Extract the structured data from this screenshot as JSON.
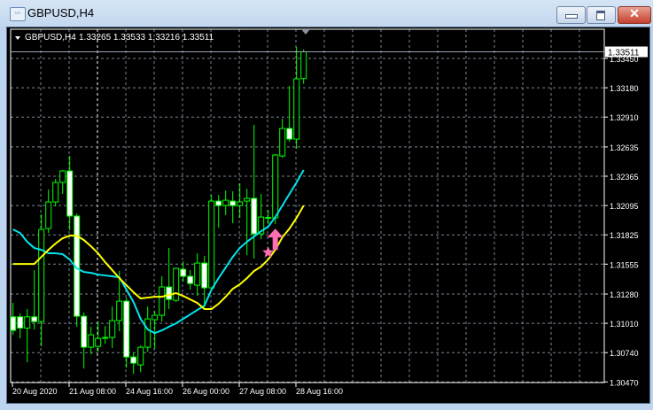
{
  "window": {
    "title": "GBPUSD,H4",
    "buttons": [
      "minimize",
      "maximize",
      "close"
    ]
  },
  "chart_header": {
    "symbol": "GBPUSD,H4",
    "ohlc": "1.33265 1.33533 1.33216 1.33511"
  },
  "colors": {
    "background": "#000000",
    "candle_outline": "#00ff00",
    "bull_body": "#000000",
    "bear_body": "#ffffff",
    "ma_fast": "#00e5ee",
    "ma_slow": "#ffff00",
    "grid": "#7a8594",
    "signal": "#ff6eb4"
  },
  "chart_data": {
    "type": "candlestick",
    "title": "GBPUSD,H4",
    "ylim": [
      1.30464,
      1.33719
    ],
    "grid": true,
    "price_labels": [
      "1.33450",
      "1.33180",
      "1.32910",
      "1.32635",
      "1.32365",
      "1.32095",
      "1.31825",
      "1.31555",
      "1.31280",
      "1.31010",
      "1.30740",
      "1.30470"
    ],
    "time_labels": [
      "20 Aug 2020",
      "21 Aug 08:00",
      "24 Aug 16:00",
      "26 Aug 00:00",
      "27 Aug 08:00",
      "28 Aug 16:00"
    ],
    "current_price": "1.33511",
    "candles": [
      [
        1.3107,
        1.31198,
        1.30904,
        1.30945
      ],
      [
        1.3107,
        1.311,
        1.30871,
        1.30966
      ],
      [
        1.30966,
        1.31141,
        1.30651,
        1.3107
      ],
      [
        1.3107,
        1.315,
        1.30953,
        1.31026
      ],
      [
        1.31026,
        1.32014,
        1.30798,
        1.31875
      ],
      [
        1.31883,
        1.32242,
        1.31842,
        1.32128
      ],
      [
        1.32128,
        1.3234,
        1.32087,
        1.32308
      ],
      [
        1.32308,
        1.32422,
        1.32202,
        1.32414
      ],
      [
        1.32414,
        1.32552,
        1.31867,
        1.31998
      ],
      [
        1.31998,
        1.32022,
        1.30978,
        1.31075
      ],
      [
        1.31075,
        1.31108,
        1.30594,
        1.3079
      ],
      [
        1.3079,
        1.30978,
        1.30725,
        1.30904
      ],
      [
        1.30798,
        1.31026,
        1.30749,
        1.30871
      ],
      [
        1.3088,
        1.30986,
        1.30822,
        1.30878
      ],
      [
        1.3088,
        1.31165,
        1.30782,
        1.31035
      ],
      [
        1.31035,
        1.31492,
        1.30937,
        1.31214
      ],
      [
        1.31214,
        1.31247,
        1.30602,
        1.307
      ],
      [
        1.307,
        1.30741,
        1.30545,
        1.30643
      ],
      [
        1.30627,
        1.30806,
        1.30561,
        1.3079
      ],
      [
        1.3079,
        1.31165,
        1.30749,
        1.31051
      ],
      [
        1.31043,
        1.31124,
        1.30774,
        1.31084
      ],
      [
        1.31084,
        1.31443,
        1.31026,
        1.31345
      ],
      [
        1.31345,
        1.31704,
        1.31141,
        1.3123
      ],
      [
        1.31222,
        1.31524,
        1.31206,
        1.31516
      ],
      [
        1.31508,
        1.31581,
        1.31394,
        1.31443
      ],
      [
        1.31443,
        1.315,
        1.3132,
        1.31377
      ],
      [
        1.31361,
        1.31655,
        1.31263,
        1.31565
      ],
      [
        1.31565,
        1.3163,
        1.31157,
        1.31337
      ],
      [
        1.31337,
        1.32193,
        1.3132,
        1.32136
      ],
      [
        1.32136,
        1.32193,
        1.31891,
        1.32095
      ],
      [
        1.32095,
        1.32234,
        1.32006,
        1.32144
      ],
      [
        1.32136,
        1.32226,
        1.31932,
        1.32095
      ],
      [
        1.32095,
        1.32299,
        1.31981,
        1.32128
      ],
      [
        1.32136,
        1.3225,
        1.31638,
        1.32161
      ],
      [
        1.32161,
        1.32838,
        1.31606,
        1.31834
      ],
      [
        1.31834,
        1.32202,
        1.31785,
        1.31989
      ],
      [
        1.31981,
        1.32055,
        1.31924,
        1.31985
      ],
      [
        1.31981,
        1.32569,
        1.31924,
        1.32561
      ],
      [
        1.32552,
        1.32895,
        1.32536,
        1.32805
      ],
      [
        1.32805,
        1.33197,
        1.32683,
        1.32707
      ],
      [
        1.32707,
        1.33556,
        1.32618,
        1.33262
      ],
      [
        1.33265,
        1.33533,
        1.33216,
        1.33511
      ]
    ],
    "ma_fast": [
      1.31875,
      1.31842,
      1.31761,
      1.31704,
      1.31687,
      1.31655,
      1.31655,
      1.31647,
      1.31598,
      1.31516,
      1.31483,
      1.31475,
      1.31459,
      1.31451,
      1.31443,
      1.31434,
      1.3132,
      1.31206,
      1.31051,
      1.30953,
      1.3092,
      1.30945,
      1.30978,
      1.3101,
      1.31051,
      1.31092,
      1.31133,
      1.31173,
      1.3132,
      1.31426,
      1.31524,
      1.31622,
      1.31704,
      1.31761,
      1.3181,
      1.31859,
      1.319,
      1.31989,
      1.32095,
      1.32202,
      1.32308,
      1.32422
    ],
    "ma_slow": [
      1.31557,
      1.31557,
      1.31557,
      1.31557,
      1.31622,
      1.31687,
      1.31745,
      1.31794,
      1.31818,
      1.31818,
      1.31777,
      1.3172,
      1.31655,
      1.31573,
      1.315,
      1.31426,
      1.31361,
      1.31296,
      1.31239,
      1.31247,
      1.31255,
      1.31255,
      1.31271,
      1.31288,
      1.31263,
      1.3123,
      1.31198,
      1.31141,
      1.31141,
      1.3119,
      1.31255,
      1.31328,
      1.31369,
      1.31426,
      1.31492,
      1.31532,
      1.31598,
      1.31687,
      1.31802,
      1.31883,
      1.31981,
      1.32095
    ],
    "signals": [
      {
        "type": "buy-arrow",
        "bar": 37,
        "price": 1.31687
      },
      {
        "type": "star",
        "bar": 36,
        "price": 1.31663
      }
    ]
  }
}
